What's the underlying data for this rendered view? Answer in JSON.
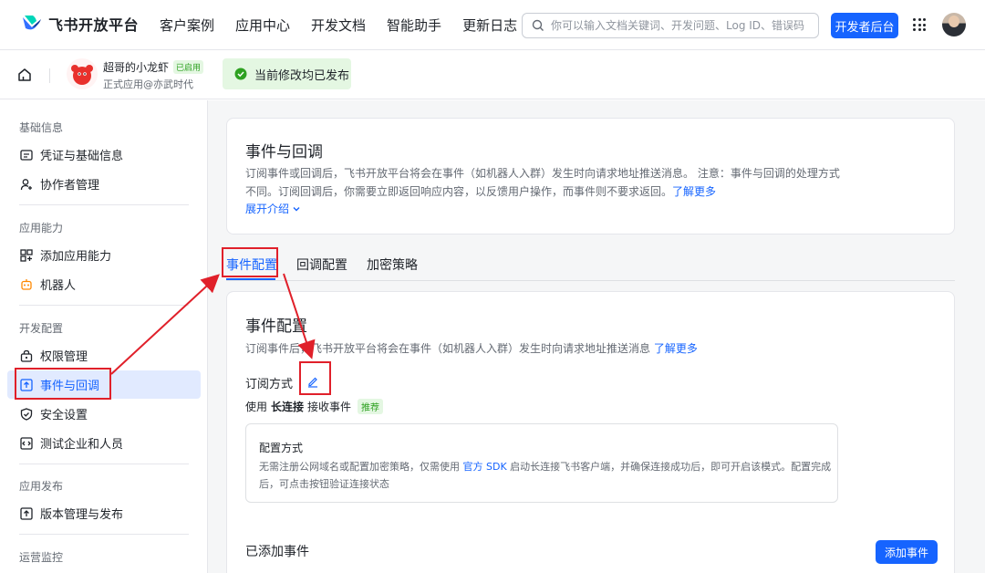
{
  "header": {
    "logo_text": "飞书开放平台",
    "nav": [
      "客户案例",
      "应用中心",
      "开发文档",
      "智能助手",
      "更新日志"
    ],
    "search_placeholder": "你可以输入文档关键词、开发问题、Log ID、错误码",
    "dev_button": "开发者后台"
  },
  "appbar": {
    "app_name": "超哥的小龙虾",
    "app_status": "已启用",
    "app_sub": "正式应用@亦武时代",
    "publish_status": "当前修改均已发布"
  },
  "sidebar": {
    "sections": [
      {
        "title": "基础信息",
        "items": [
          {
            "label": "凭证与基础信息",
            "icon": "credential-icon"
          },
          {
            "label": "协作者管理",
            "icon": "collaborator-icon"
          }
        ]
      },
      {
        "title": "应用能力",
        "items": [
          {
            "label": "添加应用能力",
            "icon": "add-capability-icon"
          },
          {
            "label": "机器人",
            "icon": "robot-icon"
          }
        ]
      },
      {
        "title": "开发配置",
        "items": [
          {
            "label": "权限管理",
            "icon": "permission-icon"
          },
          {
            "label": "事件与回调",
            "icon": "event-icon"
          },
          {
            "label": "安全设置",
            "icon": "shield-icon"
          },
          {
            "label": "测试企业和人员",
            "icon": "test-icon"
          }
        ]
      },
      {
        "title": "应用发布",
        "items": [
          {
            "label": "版本管理与发布",
            "icon": "upload-icon"
          }
        ]
      },
      {
        "title": "运营监控",
        "items": []
      }
    ],
    "active_item": "事件与回调"
  },
  "intro_card": {
    "title": "事件与回调",
    "desc": "订阅事件或回调后，飞书开放平台将会在事件（如机器人入群）发生时向请求地址推送消息。 注意：事件与回调的处理方式不同。订阅回调后，你需要立即返回响应内容，以反馈用户操作，而事件则不要求返回。",
    "learn_more": "了解更多",
    "expand": "展开介绍"
  },
  "tabs": [
    "事件配置",
    "回调配置",
    "加密策略"
  ],
  "event_card": {
    "title": "事件配置",
    "desc": "订阅事件后，飞书开放平台将会在事件（如机器人入群）发生时向请求地址推送消息",
    "learn_more": "了解更多",
    "sub_label": "订阅方式",
    "use_prefix": "使用",
    "use_method": "长连接",
    "use_suffix": "接收事件",
    "recommend": "推荐",
    "config_box": {
      "title": "配置方式",
      "desc_1": "无需注册公网域名或配置加密策略，仅需使用",
      "desc_link": "官方 SDK",
      "desc_2": "启动长连接飞书客户端，并确保连接成功后，即可开启该模式。配置完成后，可点击按钮验证连接状态"
    },
    "added_label": "已添加事件",
    "add_button": "添加事件"
  },
  "colors": {
    "accent": "#1664ff",
    "annotation": "#e0202a",
    "success_bg": "#e4f7e2"
  }
}
